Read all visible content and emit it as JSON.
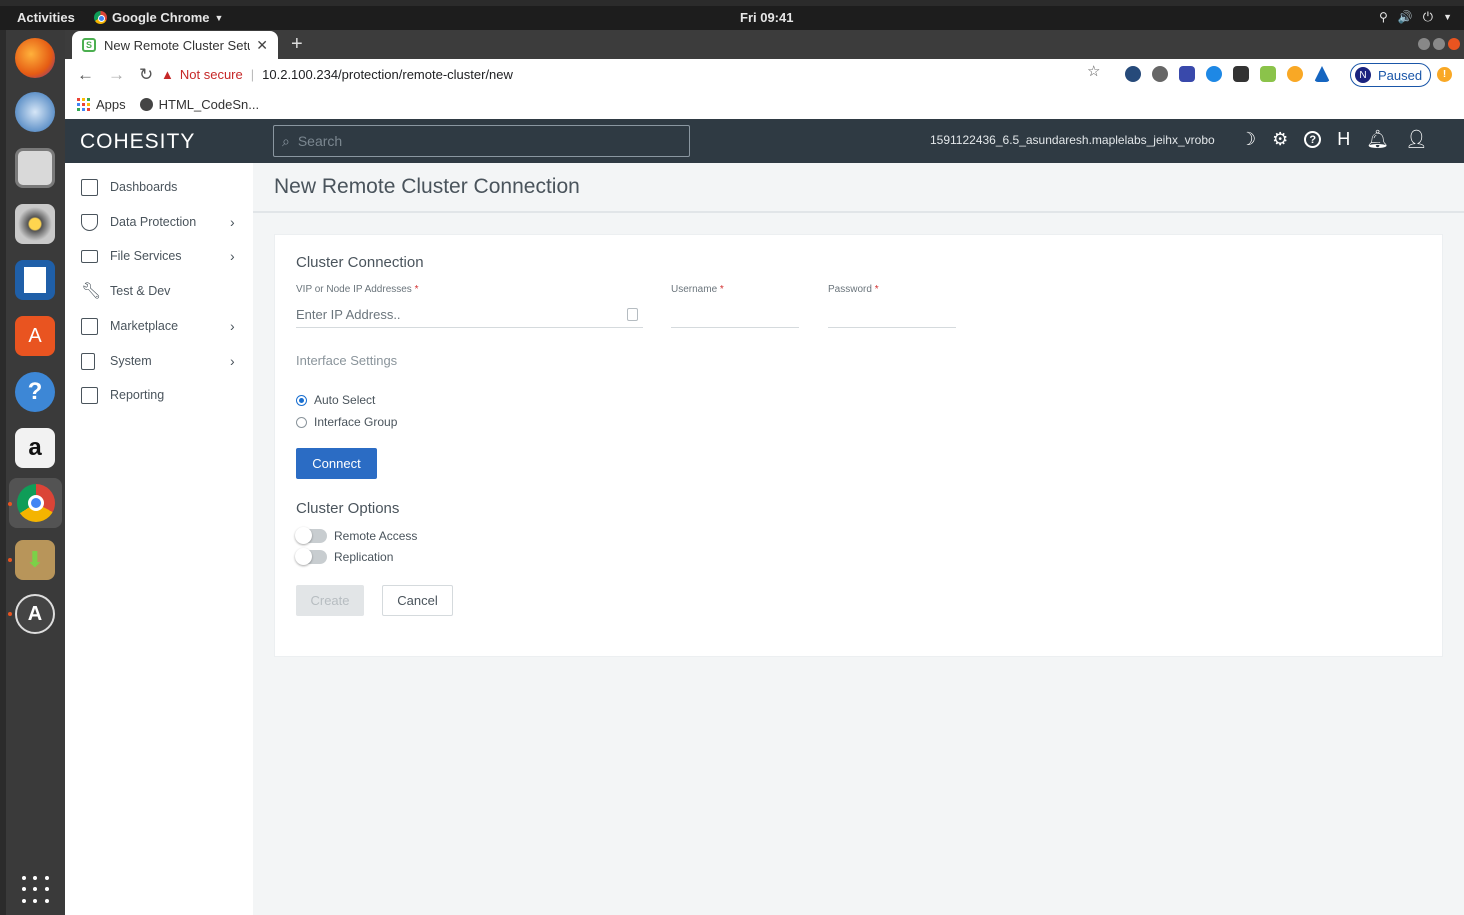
{
  "system_bar": {
    "activities": "Activities",
    "app_menu": "Google Chrome",
    "clock": "Fri 09:41"
  },
  "browser": {
    "tab_title": "New Remote Cluster Setu",
    "not_secure": "Not secure",
    "url": "10.2.100.234/protection/remote-cluster/new",
    "profile_initial": "N",
    "profile_status": "Paused",
    "bookmarks": [
      "Apps",
      "HTML_CodeSn..."
    ]
  },
  "app": {
    "logo": "COHESITY",
    "search_placeholder": "Search",
    "cluster_name": "1591122436_6.5_asundaresh.maplelabs_jeihx_vrobo",
    "help_initial": "H"
  },
  "sidebar": {
    "items": [
      {
        "label": "Dashboards",
        "icon": "dashboard-icon",
        "chevron": false
      },
      {
        "label": "Data Protection",
        "icon": "shield-icon",
        "chevron": true
      },
      {
        "label": "File Services",
        "icon": "folder-icon",
        "chevron": true
      },
      {
        "label": "Test & Dev",
        "icon": "wrench-icon",
        "chevron": false
      },
      {
        "label": "Marketplace",
        "icon": "store-icon",
        "chevron": true
      },
      {
        "label": "System",
        "icon": "server-icon",
        "chevron": true
      },
      {
        "label": "Reporting",
        "icon": "report-icon",
        "chevron": false
      }
    ]
  },
  "page": {
    "title": "New Remote Cluster Connection",
    "cluster_connection": {
      "title": "Cluster Connection",
      "ip_label": "VIP or Node IP Addresses",
      "ip_placeholder": "Enter IP Address..",
      "username_label": "Username",
      "password_label": "Password",
      "required_mark": "*"
    },
    "interface_settings": {
      "title": "Interface Settings",
      "options": [
        {
          "label": "Auto Select",
          "selected": true
        },
        {
          "label": "Interface Group",
          "selected": false
        }
      ]
    },
    "connect_button": "Connect",
    "cluster_options": {
      "title": "Cluster Options",
      "toggles": [
        {
          "label": "Remote Access",
          "on": false
        },
        {
          "label": "Replication",
          "on": false
        }
      ]
    },
    "create_button": "Create",
    "cancel_button": "Cancel"
  },
  "colors": {
    "header_bg": "#2f3a43",
    "primary": "#2b6cc4",
    "required": "#d32f2f"
  }
}
